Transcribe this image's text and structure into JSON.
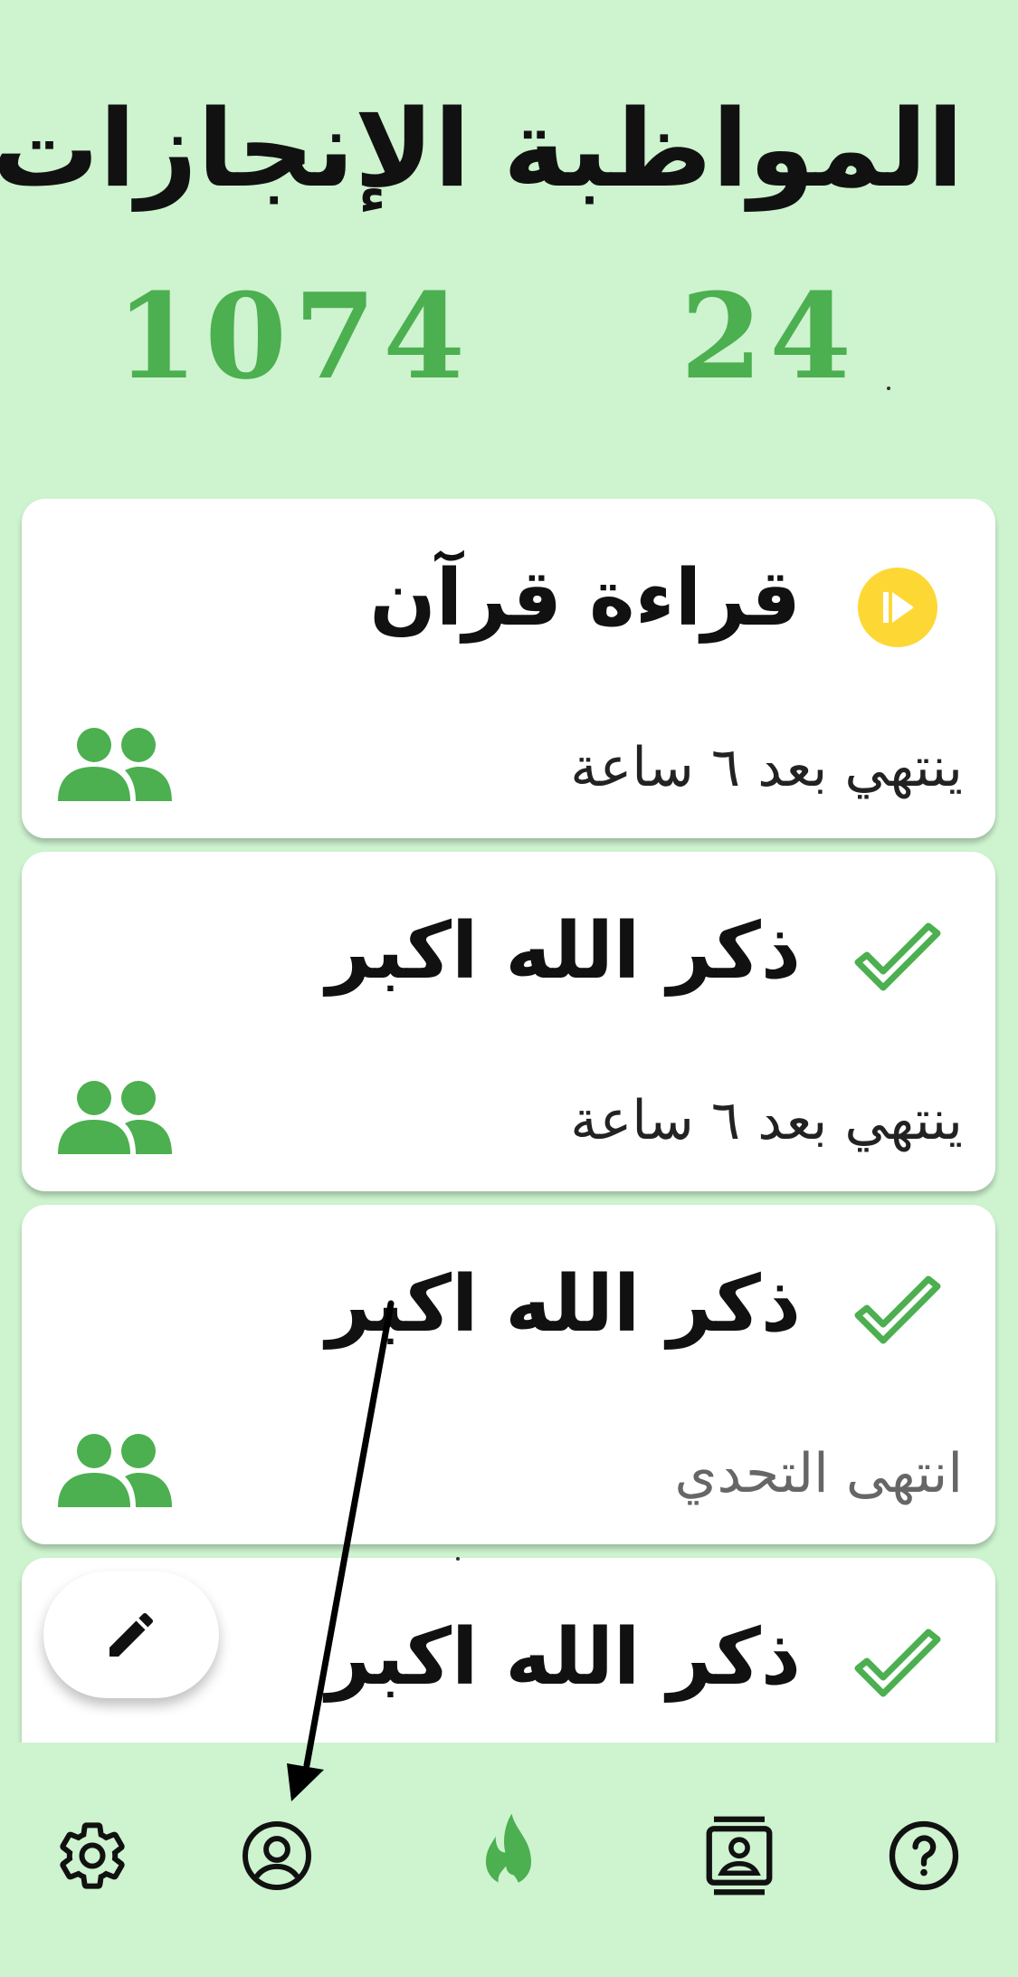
{
  "stats": {
    "achievements_label": "الإنجازات",
    "achievements_value": "1074",
    "consistency_label": "المواظبة",
    "consistency_value": "24"
  },
  "challenges": [
    {
      "title": "قراءة قرآن",
      "status": "ينتهي بعد ٦ ساعة",
      "state": "in-progress",
      "state_icon": "play-circle-icon",
      "group_icon": "group-icon"
    },
    {
      "title": "ذكر الله اكبر",
      "status": "ينتهي بعد ٦ ساعة",
      "state": "done",
      "state_icon": "check-icon",
      "group_icon": "group-icon"
    },
    {
      "title": "ذكر الله اكبر",
      "status": "انتهى التحدي",
      "state": "done",
      "state_icon": "check-icon",
      "group_icon": "group-icon"
    },
    {
      "title": "ذكر الله اكبر",
      "status": "",
      "state": "done",
      "state_icon": "check-icon",
      "group_icon": "group-icon"
    }
  ],
  "fab": {
    "icon": "pencil-icon"
  },
  "nav": {
    "items": [
      {
        "icon": "gear-icon",
        "name": "settings"
      },
      {
        "icon": "profile-icon",
        "name": "profile"
      },
      {
        "icon": "flame-icon",
        "name": "challenges",
        "active": true
      },
      {
        "icon": "contact-card-icon",
        "name": "contacts"
      },
      {
        "icon": "help-icon",
        "name": "help"
      }
    ]
  },
  "colors": {
    "background": "#cdf3cf",
    "accent": "#4caf50",
    "in_progress": "#fdd835",
    "card": "#ffffff"
  }
}
